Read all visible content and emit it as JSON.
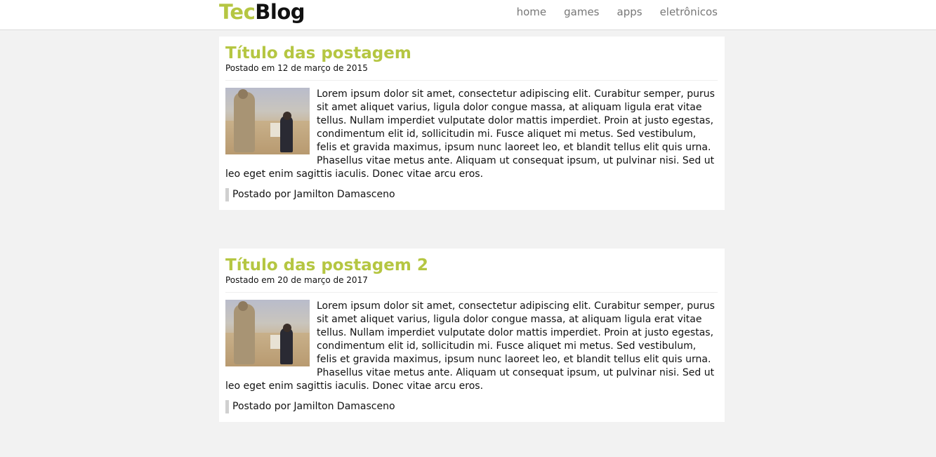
{
  "header": {
    "logo_part1": "Tec",
    "logo_part2": "Blog",
    "nav": [
      "home",
      "games",
      "apps",
      "eletrônicos"
    ]
  },
  "posts": [
    {
      "title": "Título das postagem",
      "date": "Postado em 12 de março de 2015",
      "body": "Lorem ipsum dolor sit amet, consectetur adipiscing elit. Curabitur semper, purus sit amet aliquet varius, ligula dolor congue massa, at aliquam ligula erat vitae tellus. Nullam imperdiet vulputate dolor mattis imperdiet. Proin at justo egestas, condimentum elit id, sollicitudin mi. Fusce aliquet mi metus. Sed vestibulum, felis et gravida maximus, ipsum nunc laoreet leo, et blandit tellus elit quis urna. Phasellus vitae metus ante. Aliquam ut consequat ipsum, ut pulvinar nisi. Sed ut leo eget enim sagittis iaculis. Donec vitae arcu eros.",
      "author": "Postado por Jamilton Damasceno",
      "image_icon": "soldier-child-photo"
    },
    {
      "title": "Título das postagem 2",
      "date": "Postado em 20 de março de 2017",
      "body": "Lorem ipsum dolor sit amet, consectetur adipiscing elit. Curabitur semper, purus sit amet aliquet varius, ligula dolor congue massa, at aliquam ligula erat vitae tellus. Nullam imperdiet vulputate dolor mattis imperdiet. Proin at justo egestas, condimentum elit id, sollicitudin mi. Fusce aliquet mi metus. Sed vestibulum, felis et gravida maximus, ipsum nunc laoreet leo, et blandit tellus elit quis urna. Phasellus vitae metus ante. Aliquam ut consequat ipsum, ut pulvinar nisi. Sed ut leo eget enim sagittis iaculis. Donec vitae arcu eros.",
      "author": "Postado por Jamilton Damasceno",
      "image_icon": "soldier-child-photo"
    }
  ],
  "colors": {
    "accent": "#b5c642",
    "background": "#f2f2f2",
    "card": "#ffffff",
    "nav_text": "#777777"
  }
}
